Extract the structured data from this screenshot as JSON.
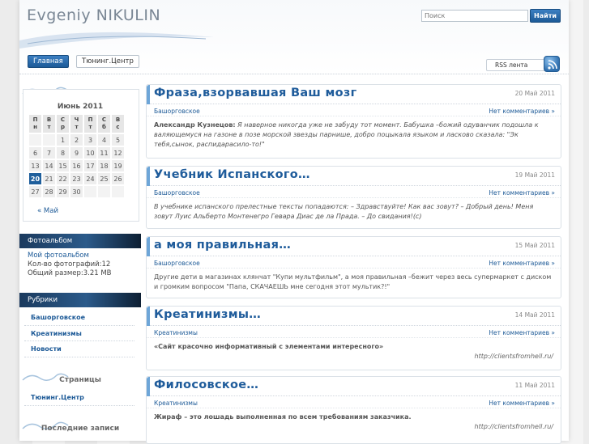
{
  "header": {
    "site_title": "Evgeniy NIKULIN",
    "search_placeholder": "Поиск",
    "search_button": "Найти",
    "nav": [
      "Главная",
      "Тюнинг.Центр"
    ],
    "rss_label": "RSS лента"
  },
  "calendar": {
    "caption": "Июнь 2011",
    "weekdays": [
      "Пн",
      "Вт",
      "Ср",
      "Чт",
      "Пт",
      "Сб",
      "Вс"
    ],
    "weeks": [
      [
        "",
        "",
        "1",
        "2",
        "3",
        "4",
        "5"
      ],
      [
        "6",
        "7",
        "8",
        "9",
        "10",
        "11",
        "12"
      ],
      [
        "13",
        "14",
        "15",
        "16",
        "17",
        "18",
        "19"
      ],
      [
        "20",
        "21",
        "22",
        "23",
        "24",
        "25",
        "26"
      ],
      [
        "27",
        "28",
        "29",
        "30",
        "",
        "",
        ""
      ]
    ],
    "today": "20",
    "prev_link": "« Май"
  },
  "photo_album": {
    "title": "Фотоальбом",
    "link": "Мой фотоальбом",
    "count": "Кол-во фотографий:12",
    "size": "Общий размер:3.21 MB"
  },
  "categories": {
    "title": "Рубрики",
    "items": [
      "Башорговское",
      "Креатинизмы",
      "Новости"
    ]
  },
  "pages": {
    "title": "Страницы",
    "items": [
      "Тюнинг.Центр"
    ]
  },
  "recent": {
    "title": "Последние записи"
  },
  "posts": [
    {
      "title": "Фраза,взорвавшая Ваш мозг",
      "date": "20 Май 2011",
      "category": "Башорговское",
      "comments": "Нет комментариев »",
      "author": "Александр Кузнецов:",
      "text": "Я наверное никогда уже не забуду тот момент. Бабушка –божий одуванчик подошла к валяющемуся на газоне в позе морской звезды парнише, добро поцыкала языком и ласково сказала: \"Эк тебя,сынок, распидарасило-то!\""
    },
    {
      "title": "Учебник Испанского…",
      "date": "19 Май 2011",
      "category": "Башорговское",
      "comments": "Нет комментариев »",
      "text": "В учебнике испанского прелестные тексты попадаются: – Здравствуйте! Как вас зовут? – Добрый день! Меня зовут Луис Альберто Монтенегро Гевара Диас де ла Прада. – До свидания!(с)"
    },
    {
      "title": "а моя правильная…",
      "date": "15 Май 2011",
      "category": "Башорговское",
      "comments": "Нет комментариев »",
      "text": "Другие дети в магазинах клянчат \"Купи мультфильм\", а моя правильная –бежит через весь супермаркет с диском и громким вопросом \"Папа, СКАЧАЕШЬ мне сегодня этот мультик?!\""
    },
    {
      "title": "Креатинизмы…",
      "date": "14 Май 2011",
      "category": "Креатинизмы",
      "comments": "Нет комментариев »",
      "text": "«Сайт красочно информативный с элементами интересного»",
      "url": "http://clientsfromhell.ru/"
    },
    {
      "title": "Филосовское…",
      "date": "11 Май 2011",
      "category": "Креатинизмы",
      "comments": "Нет комментариев »",
      "text": "Жираф – это лошадь выполненная по всем требованиям заказчика.",
      "url": "http://clientsfromhell.ru/"
    }
  ]
}
